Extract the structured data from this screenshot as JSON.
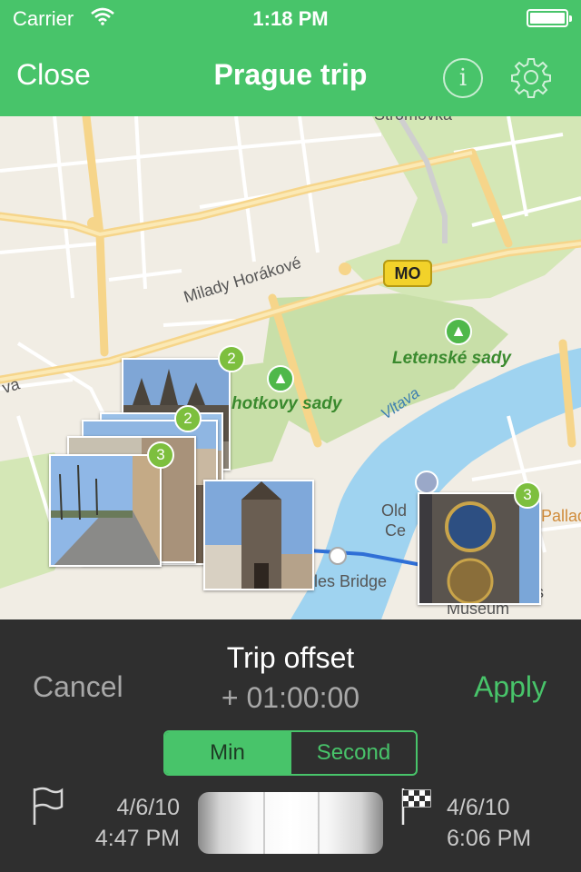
{
  "status_bar": {
    "carrier": "Carrier",
    "time": "1:18 PM"
  },
  "nav": {
    "close_label": "Close",
    "title": "Prague trip",
    "info_icon": "i"
  },
  "map": {
    "labels": {
      "stromovka": "Stromovka",
      "milady": "Milady Horákové",
      "mo": "MO",
      "letenske": "Letenské sady",
      "chotkovy": "hotkovy sady",
      "vltava": "Vltava",
      "old_ce_1": "Old",
      "old_ce_2": "Ce",
      "bridge": "les Bridge",
      "museum": "Museum",
      "palad": "Pallad",
      "va": "va",
      "s": "s"
    },
    "photo_badges": {
      "castle": "2",
      "stack": "2",
      "street": "3",
      "clock": "3"
    }
  },
  "panel": {
    "cancel_label": "Cancel",
    "apply_label": "Apply",
    "offset_title": "Trip offset",
    "offset_value": "+ 01:00:00",
    "segments": {
      "min": "Min",
      "second": "Second",
      "selected": "Min"
    },
    "start": {
      "date": "4/6/10",
      "time": "4:47 PM"
    },
    "end": {
      "date": "4/6/10",
      "time": "6:06 PM"
    }
  },
  "colors": {
    "accent": "#48c46a",
    "panel": "#2f2f2f",
    "badge": "#7dbf3e",
    "river": "#9fd3f0",
    "park": "#c8dfa8"
  }
}
